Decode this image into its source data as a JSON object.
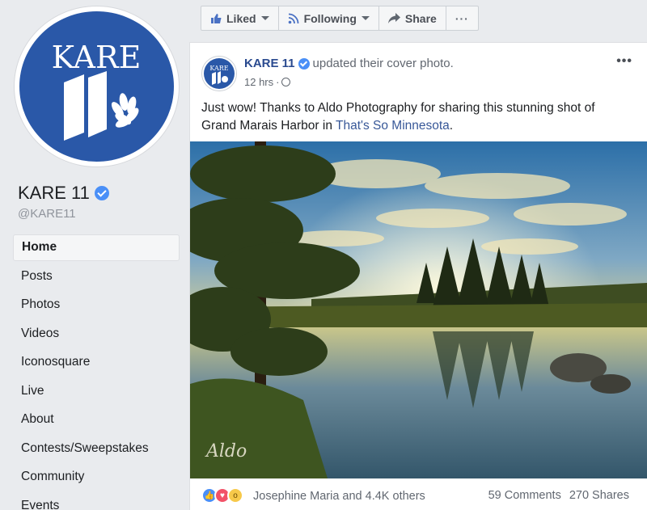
{
  "page": {
    "logo_text": "KARE",
    "logo_number": "11",
    "name": "KARE 11",
    "handle": "@KARE11"
  },
  "nav": {
    "items": [
      {
        "label": "Home",
        "active": true
      },
      {
        "label": "Posts"
      },
      {
        "label": "Photos"
      },
      {
        "label": "Videos"
      },
      {
        "label": "Iconosquare"
      },
      {
        "label": "Live"
      },
      {
        "label": "About"
      },
      {
        "label": "Contests/Sweepstakes"
      },
      {
        "label": "Community"
      },
      {
        "label": "Events"
      }
    ]
  },
  "actions": {
    "liked": "Liked",
    "following": "Following",
    "share": "Share",
    "more": "···"
  },
  "post": {
    "avatar_text": "KARE",
    "author": "KARE 11",
    "action_text": "updated their cover photo.",
    "time": "12 hrs",
    "time_separator": "·",
    "more": "•••",
    "text_before_link": "Just wow! Thanks to Aldo Photography for sharing this stunning shot of Grand Marais Harbor in ",
    "link_text": "That's So Minnesota",
    "text_after_link": ".",
    "watermark": "Aldo",
    "reactions_text": "Josephine Maria and 4.4K others",
    "comments": "59 Comments",
    "shares": "270 Shares"
  },
  "colors": {
    "brand_blue": "#2a58a8",
    "link": "#385898",
    "verified": "#4a8ff7"
  },
  "icons": {
    "liked": "thumbs-up-icon",
    "following": "rss-feed-icon",
    "share": "share-arrow-icon",
    "audience": "globe-icon"
  }
}
